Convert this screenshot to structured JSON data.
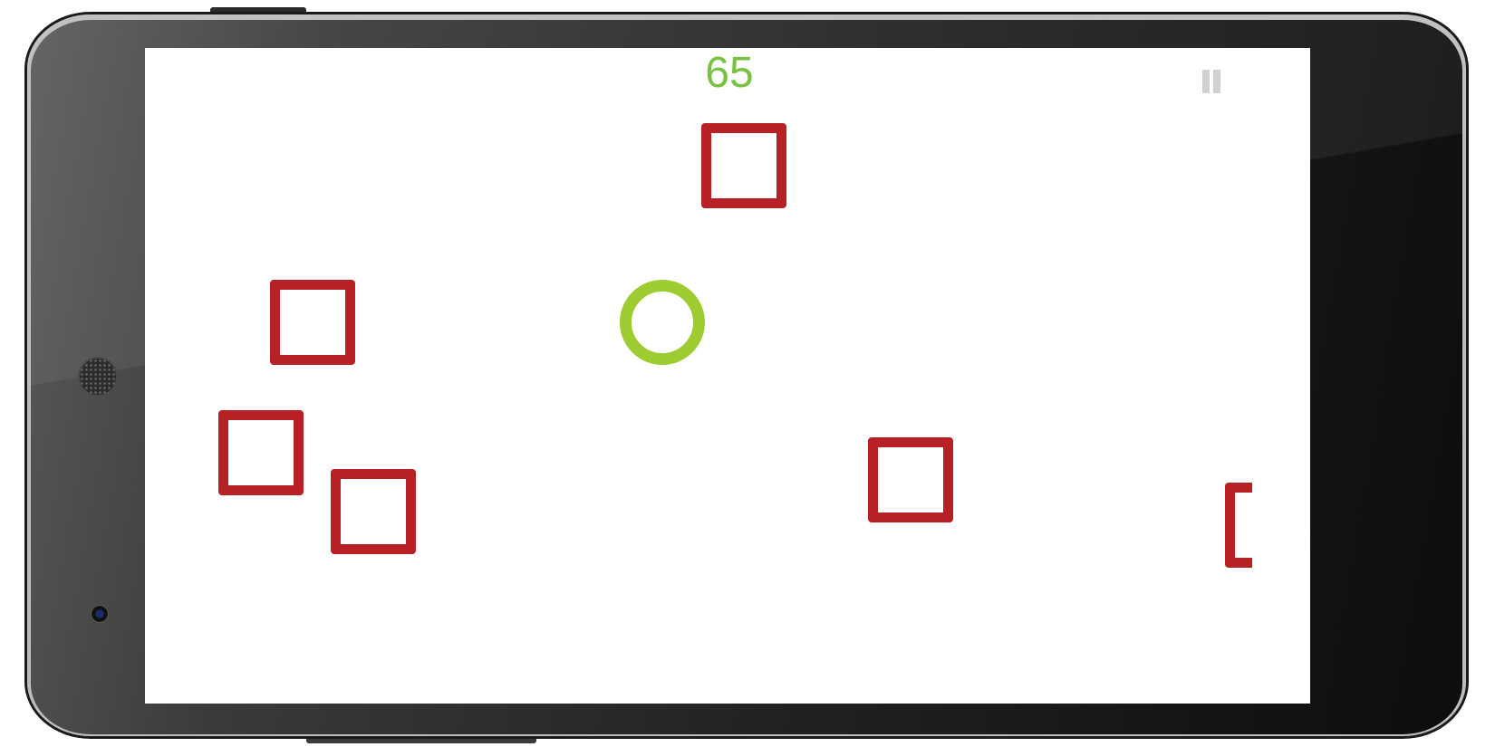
{
  "game": {
    "score": "65",
    "player_color": "#9ccc2f",
    "score_color": "#7ac143",
    "obstacle_color": "#b72024",
    "pause_icon": "pause-icon"
  },
  "device": {
    "type": "phone-landscape"
  }
}
